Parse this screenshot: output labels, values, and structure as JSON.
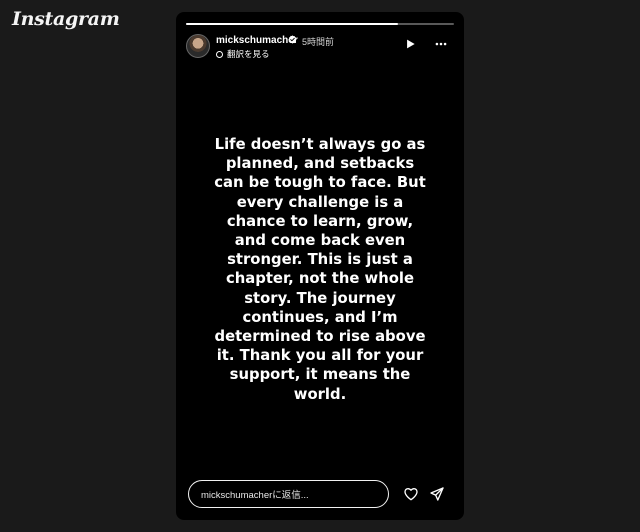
{
  "app": {
    "logo_text": "Instagram"
  },
  "story": {
    "progress_fraction": 0.79,
    "user": {
      "username": "mickschumacher",
      "verified": true,
      "time": "5時間前",
      "translate_label": "翻訳を見る",
      "avatar": "profile-photo"
    },
    "controls": {
      "play_icon": "play-icon",
      "more_icon": "more-icon"
    },
    "body_text": "Life doesn’t always go as\nplanned, and setbacks\ncan be tough to face. But\nevery challenge is a\nchance to learn, grow,\nand come back even\nstronger. This is just a\nchapter, not the whole\nstory. The journey\ncontinues, and I’m\ndetermined to rise above\nit. Thank you all for your\nsupport, it means the\nworld.",
    "reply_placeholder": "mickschumacherに返信...",
    "actions": {
      "heart_icon": "heart-icon",
      "share_icon": "send-icon"
    }
  },
  "colors": {
    "page_background": "#1a1a1a",
    "story_background": "#000000",
    "text": "#ffffff",
    "verified_badge": "#ffffff"
  }
}
